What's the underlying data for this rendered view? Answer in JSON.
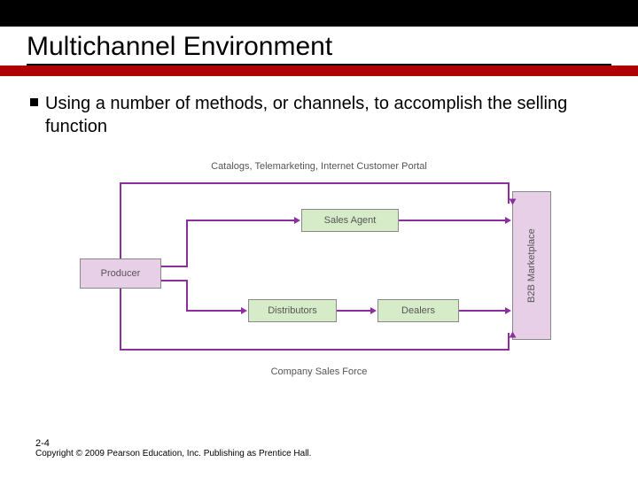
{
  "slide": {
    "title": "Multichannel Environment",
    "bullet": "Using a number of methods, or channels, to accomplish the selling function",
    "page_number": "2-4",
    "copyright": "Copyright © 2009 Pearson Education, Inc. Publishing as Prentice Hall."
  },
  "diagram": {
    "top_label": "Catalogs, Telemarketing, Internet Customer Portal",
    "bottom_label": "Company Sales Force",
    "nodes": {
      "producer": "Producer",
      "sales_agent": "Sales Agent",
      "distributors": "Distributors",
      "dealers": "Dealers",
      "marketplace": "B2B Marketplace"
    }
  }
}
